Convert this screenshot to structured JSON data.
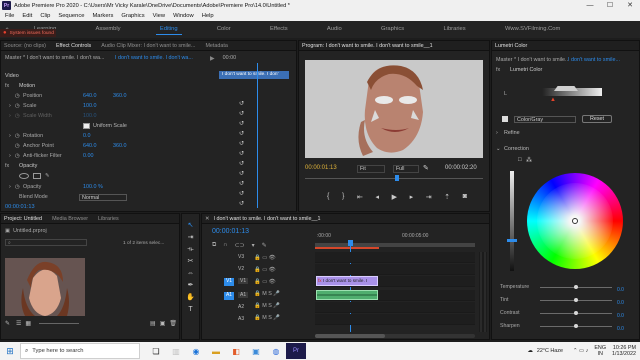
{
  "window": {
    "title": "Adobe Premiere Pro 2020 - C:\\Users\\Mr Vicky Karale\\OneDrive\\Documents\\Adobe\\Premiere Pro\\14.0\\Untitled *",
    "logo": "Pr",
    "min": "—",
    "max": "☐",
    "close": "✕"
  },
  "menu": [
    "File",
    "Edit",
    "Clip",
    "Sequence",
    "Markers",
    "Graphics",
    "View",
    "Window",
    "Help"
  ],
  "workspaces": {
    "items": [
      "Learning",
      "Assembly",
      "Editing",
      "Color",
      "Effects",
      "Audio",
      "Graphics",
      "Libraries",
      "Www.SVFilming.Com"
    ],
    "active": "Editing"
  },
  "system_issue": "System issues found",
  "source_panel": {
    "tabs": [
      "Source: (no clips)",
      "Effect Controls",
      "Audio Clip Mixer: I don't want to smile...",
      "Metadata"
    ],
    "master": "Master * I don't want to smile. I don't wa...",
    "clip": "I don't want to smile. I don't wa...",
    "timecode": "00:00",
    "clip_strip": "I don't want to smile. I don'",
    "video_header": "Video",
    "motion": "Motion",
    "position_lbl": "Position",
    "position_x": "640.0",
    "position_y": "360.0",
    "scale_lbl": "Scale",
    "scale_val": "100.0",
    "scale_w_lbl": "Scale Width",
    "scale_w_val": "100.0",
    "uniform_lbl": "Uniform Scale",
    "rotation_lbl": "Rotation",
    "rotation_val": "0.0",
    "anchor_lbl": "Anchor Point",
    "anchor_x": "640.0",
    "anchor_y": "360.0",
    "flicker_lbl": "Anti-flicker Filter",
    "flicker_val": "0.00",
    "opacity": "Opacity",
    "opacity_lbl": "Opacity",
    "opacity_val": "100.0 %",
    "blend_lbl": "Blend Mode",
    "blend_val": "Normal",
    "bottom_tc": "00:00:01:13"
  },
  "program": {
    "tab": "Program: I don't want to smile. I don't want to smile__1",
    "timecode": "00:00:01:13",
    "fit": "Fit",
    "quality": "Full",
    "duration": "00:00:02:20"
  },
  "lumetri": {
    "tab": "Lumetri Color",
    "master": "Master * I don't want to smile...",
    "clip": "I don't want to smile...",
    "effect": "Lumetri Color",
    "l_label": "L",
    "colorgray": "Color/Gray",
    "reset": "Reset",
    "refine": "Refine",
    "correction": "Correction",
    "sliders": [
      "Temperature",
      "Tint",
      "Contrast",
      "Sharpen"
    ],
    "slider_values": [
      0.5,
      0.5,
      0.5,
      0.5
    ]
  },
  "project": {
    "tabs": [
      "Project: Untitled",
      "Media Browser",
      "Libraries"
    ],
    "file": "Untitled.prproj",
    "items_count": "1 of 2 items selec..."
  },
  "timeline": {
    "tab": "I don't want to smile. I don't want to smile__1",
    "timecode": "00:00:01:13",
    "ruler_start": ":00:00",
    "ruler_mid": "00:00:05:00",
    "tracks_v": [
      "V3",
      "V2",
      "V1"
    ],
    "tracks_a": [
      "A1",
      "A2",
      "A3"
    ],
    "clip_label": "I don't want to smile. I"
  },
  "taskbar": {
    "search": "Type here to search",
    "weather": "22°C Haze",
    "lang": "ENG",
    "lang2": "IN",
    "time": "10:26 PM",
    "date": "1/13/2022"
  },
  "colors": {
    "accent": "#2d8ceb",
    "clip": "#a991e9",
    "audio_clip": "#4fae6e",
    "playhead": "#2d8ceb"
  }
}
